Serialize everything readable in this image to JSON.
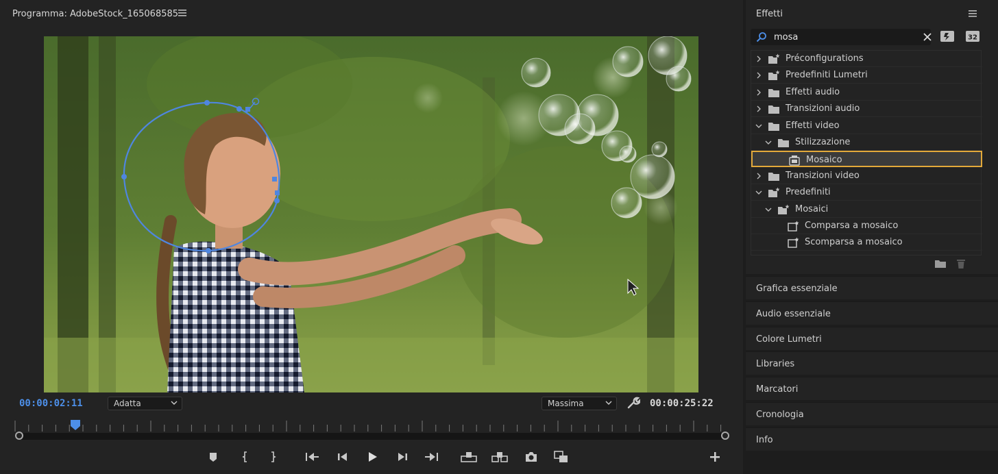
{
  "monitor": {
    "title": "Programma: AdobeStock_165068585",
    "current_timecode": "00:00:02:11",
    "duration_timecode": "00:00:25:22",
    "fit_dropdown": "Adatta",
    "quality_dropdown": "Massima",
    "playhead_fraction": 0.087
  },
  "effects": {
    "title": "Effetti",
    "search_value": "mosa",
    "tree": [
      {
        "label": "Préconfigurations",
        "level": 0,
        "expanded": false,
        "icon": "preset-folder-icon"
      },
      {
        "label": "Predefiniti Lumetri",
        "level": 0,
        "expanded": false,
        "icon": "preset-folder-icon"
      },
      {
        "label": "Effetti audio",
        "level": 0,
        "expanded": false,
        "icon": "folder-icon"
      },
      {
        "label": "Transizioni audio",
        "level": 0,
        "expanded": false,
        "icon": "folder-icon"
      },
      {
        "label": "Effetti video",
        "level": 0,
        "expanded": true,
        "icon": "folder-icon"
      },
      {
        "label": "Stilizzazione",
        "level": 1,
        "expanded": true,
        "icon": "folder-icon"
      },
      {
        "label": "Mosaico",
        "level": 2,
        "leaf": true,
        "selected": true,
        "icon": "effect-icon"
      },
      {
        "label": "Transizioni video",
        "level": 0,
        "expanded": false,
        "icon": "folder-icon"
      },
      {
        "label": "Predefiniti",
        "level": 0,
        "expanded": true,
        "icon": "preset-folder-icon"
      },
      {
        "label": "Mosaici",
        "level": 1,
        "expanded": true,
        "icon": "preset-folder-icon"
      },
      {
        "label": "Comparsa a mosaico",
        "level": 2,
        "leaf": true,
        "icon": "preset-icon"
      },
      {
        "label": "Scomparsa a mosaico",
        "level": 2,
        "leaf": true,
        "icon": "preset-icon"
      }
    ]
  },
  "panels": [
    {
      "label": "Grafica essenziale"
    },
    {
      "label": "Audio essenziale"
    },
    {
      "label": "Colore Lumetri"
    },
    {
      "label": "Libraries"
    },
    {
      "label": "Marcatori"
    },
    {
      "label": "Cronologia"
    },
    {
      "label": "Info"
    }
  ],
  "colors": {
    "accent_blue": "#4d8fe8",
    "selection_outline": "#e3a93a",
    "mask_path": "#4f86e0"
  }
}
